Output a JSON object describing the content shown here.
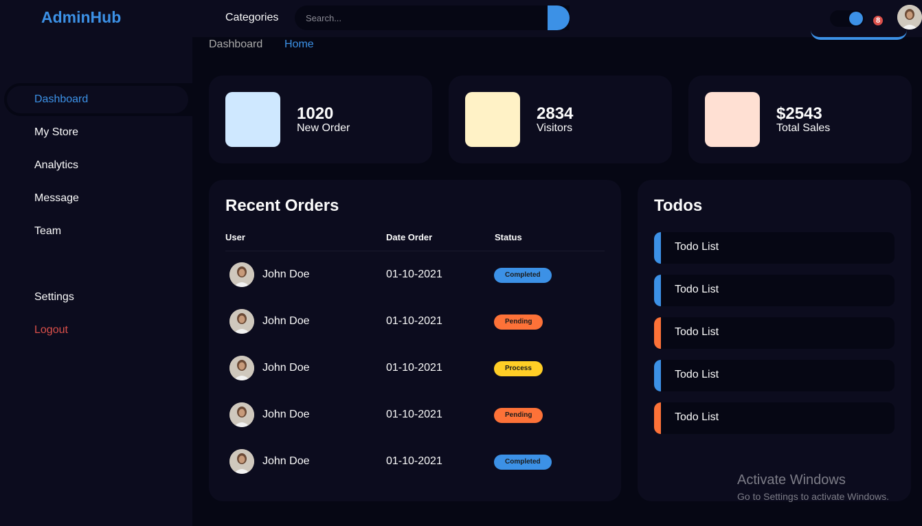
{
  "brand": "AdminHub",
  "sidebar": {
    "top_items": [
      {
        "label": "Dashboard"
      },
      {
        "label": "My Store"
      },
      {
        "label": "Analytics"
      },
      {
        "label": "Message"
      },
      {
        "label": "Team"
      }
    ],
    "bottom_items": [
      {
        "label": "Settings"
      },
      {
        "label": "Logout"
      }
    ]
  },
  "topbar": {
    "categories_label": "Categories",
    "search_placeholder": "Search...",
    "notification_count": "8"
  },
  "breadcrumb": {
    "first": "Dashboard",
    "second": "Home"
  },
  "stats": [
    {
      "value": "1020",
      "label": "New Order",
      "color": "#cfe8ff"
    },
    {
      "value": "2834",
      "label": "Visitors",
      "color": "#fff2c6"
    },
    {
      "value": "$2543",
      "label": "Total Sales",
      "color": "#ffe0d3"
    }
  ],
  "orders": {
    "title": "Recent Orders",
    "columns": [
      "User",
      "Date Order",
      "Status"
    ],
    "rows": [
      {
        "user": "John Doe",
        "date": "01-10-2021",
        "status": "Completed",
        "status_color": "#3c91e6"
      },
      {
        "user": "John Doe",
        "date": "01-10-2021",
        "status": "Pending",
        "status_color": "#fd7238"
      },
      {
        "user": "John Doe",
        "date": "01-10-2021",
        "status": "Process",
        "status_color": "#ffce26"
      },
      {
        "user": "John Doe",
        "date": "01-10-2021",
        "status": "Pending",
        "status_color": "#fd7238"
      },
      {
        "user": "John Doe",
        "date": "01-10-2021",
        "status": "Completed",
        "status_color": "#3c91e6"
      }
    ]
  },
  "todos": {
    "title": "Todos",
    "items": [
      {
        "label": "Todo List",
        "color": "#3c91e6"
      },
      {
        "label": "Todo List",
        "color": "#3c91e6"
      },
      {
        "label": "Todo List",
        "color": "#fd7238"
      },
      {
        "label": "Todo List",
        "color": "#3c91e6"
      },
      {
        "label": "Todo List",
        "color": "#fd7238"
      }
    ]
  },
  "watermark": {
    "line1": "Activate Windows",
    "line2": "Go to Settings to activate Windows."
  }
}
